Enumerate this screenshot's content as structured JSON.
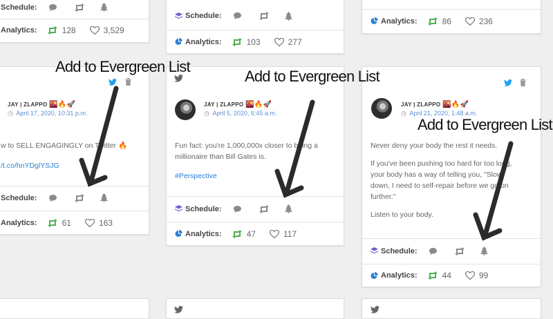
{
  "labels": {
    "schedule": "Schedule:",
    "analytics": "Analytics:",
    "annotation": "Add to Evergreen List"
  },
  "colors": {
    "retweet_green": "#4caf50",
    "twitter_blue": "#1da1f2",
    "schedule_purple": "#6b63d6",
    "link_blue": "#2b7fd6"
  },
  "icons": [
    "comment-icon",
    "retweet-icon",
    "tree-icon",
    "layers-icon",
    "pie-chart-icon",
    "heart-icon",
    "twitter-icon",
    "trash-icon",
    "clock-icon"
  ],
  "top_cards": [
    {
      "retweets": "128",
      "likes": "3,529"
    },
    {
      "retweets": "103",
      "likes": "277"
    },
    {
      "retweets": "86",
      "likes": "236"
    }
  ],
  "cards": [
    {
      "author": "JAY | ZLAPPO",
      "emoji": "🌇🔥🚀",
      "date": "April 17, 2020, 10:31 p.m.",
      "text_lines": [
        "w to SELL ENGAGINGLY on Twitter 🔥"
      ],
      "link": "t.co/hnYDglYSJG",
      "retweets": "61",
      "likes": "163"
    },
    {
      "author": "JAY | ZLAPPO",
      "emoji": "🌇🔥🚀",
      "date": "April 5, 2020, 6:45 a.m.",
      "text_lines": [
        "Fun fact: you're 1,000,000x closer to being a",
        "millionaire than Bill Gates is."
      ],
      "hashtag": "#Perspective",
      "retweets": "47",
      "likes": "117"
    },
    {
      "author": "JAY | ZLAPPO",
      "emoji": "🌇🔥🚀",
      "date": "April 21, 2020, 1:48 a.m.",
      "text_lines": [
        "Never deny your body the rest it needs.",
        "",
        "If you've been pushing too hard for too long,",
        "your body has a way of telling you, \"Slow",
        "down, I need to self-repair before we go on",
        "further.\"",
        "",
        "Listen to your body."
      ],
      "retweets": "44",
      "likes": "99"
    }
  ]
}
